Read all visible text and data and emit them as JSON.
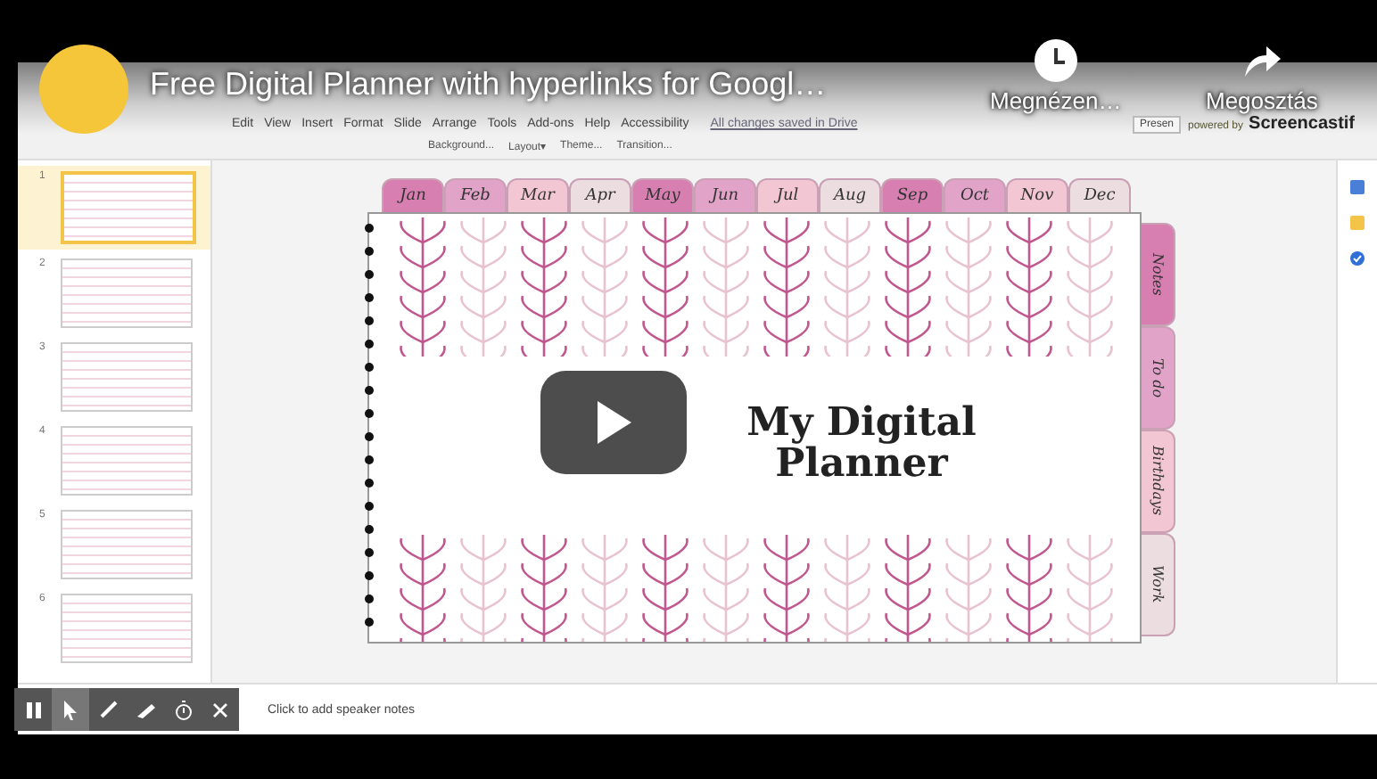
{
  "video": {
    "title": "Free Digital Planner with hyperlinks for Googl…",
    "watch_later": "Megnézen…",
    "share": "Megosztás"
  },
  "recorder": {
    "powered_by": "powered by",
    "brand": "Screencastif"
  },
  "slides_app": {
    "menu": [
      "Edit",
      "View",
      "Insert",
      "Format",
      "Slide",
      "Arrange",
      "Tools",
      "Add-ons",
      "Help",
      "Accessibility"
    ],
    "save_status": "All changes saved in Drive",
    "present_button": "Presen",
    "toolbar": [
      "Background...",
      "Layout▾",
      "Theme...",
      "Transition..."
    ],
    "slides": [
      {
        "number": "1",
        "selected": true
      },
      {
        "number": "2",
        "selected": false
      },
      {
        "number": "3",
        "selected": false
      },
      {
        "number": "4",
        "selected": false
      },
      {
        "number": "5",
        "selected": false
      },
      {
        "number": "6",
        "selected": false
      }
    ],
    "speaker_notes": {
      "placeholder": "Click to add speaker notes"
    }
  },
  "planner": {
    "title": "My Digital Planner",
    "months": [
      {
        "label": "Jan",
        "color": "#d77fb0"
      },
      {
        "label": "Feb",
        "color": "#e2a3c8"
      },
      {
        "label": "Mar",
        "color": "#f2c6d3"
      },
      {
        "label": "Apr",
        "color": "#ecdde1"
      },
      {
        "label": "May",
        "color": "#d77fb0"
      },
      {
        "label": "Jun",
        "color": "#e2a3c8"
      },
      {
        "label": "Jul",
        "color": "#f2c6d3"
      },
      {
        "label": "Aug",
        "color": "#ecdde1"
      },
      {
        "label": "Sep",
        "color": "#d77fb0"
      },
      {
        "label": "Oct",
        "color": "#e2a3c8"
      },
      {
        "label": "Nov",
        "color": "#f2c6d3"
      },
      {
        "label": "Dec",
        "color": "#ecdde1"
      }
    ],
    "sections": [
      {
        "label": "Notes",
        "color": "#d77fb0"
      },
      {
        "label": "To do",
        "color": "#e2a3c8"
      },
      {
        "label": "Birthdays",
        "color": "#f2c6d3"
      },
      {
        "label": "Work",
        "color": "#ecdde1"
      }
    ]
  }
}
